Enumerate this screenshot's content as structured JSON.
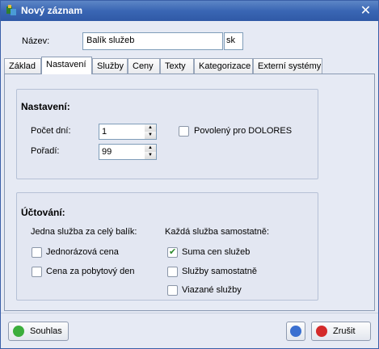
{
  "window": {
    "title": "Nový záznam",
    "close_glyph": "✕"
  },
  "name_field": {
    "label": "Název:",
    "value": "Balík služeb",
    "lang": "sk"
  },
  "tabs": [
    {
      "label": "Základ"
    },
    {
      "label": "Nastavení",
      "active": true
    },
    {
      "label": "Služby"
    },
    {
      "label": "Ceny"
    },
    {
      "label": "Texty"
    },
    {
      "label": "Kategorizace"
    },
    {
      "label": "Externí systémy"
    }
  ],
  "settings": {
    "title": "Nastavení:",
    "day_count_label": "Počet dní:",
    "day_count_value": "1",
    "order_label": "Pořadí:",
    "order_value": "99",
    "dolores_label": "Povolený pro DOLORES",
    "dolores_checked": false
  },
  "billing": {
    "title": "Účtování:",
    "left_heading": "Jedna služba za celý balík:",
    "right_heading": "Každá služba samostatně:",
    "left_options": [
      {
        "label": "Jednorázová cena",
        "checked": false
      },
      {
        "label": "Cena za pobytový den",
        "checked": false
      }
    ],
    "right_options": [
      {
        "label": "Suma cen služeb",
        "checked": true
      },
      {
        "label": "Služby samostatně",
        "checked": false
      },
      {
        "label": "Viazané služby",
        "checked": false
      }
    ]
  },
  "buttons": {
    "ok_label": "Souhlas",
    "cancel_label": "Zrušit"
  },
  "colors": {
    "titlebar": "#3a66b4",
    "ok_icon": "#3cae3c",
    "cancel_icon": "#d42a2a",
    "help_icon": "#3a6fd0"
  }
}
